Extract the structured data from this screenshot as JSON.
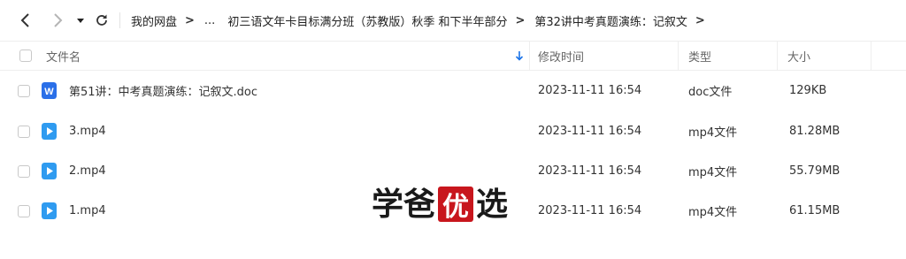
{
  "nav": {
    "back_icon": "chevron-left-icon",
    "forward_icon": "chevron-right-icon",
    "history_icon": "caret-down-icon",
    "refresh_icon": "refresh-icon"
  },
  "breadcrumb": {
    "items": [
      "我的网盘",
      "...",
      "初三语文年卡目标满分班（苏教版）秋季 和下半年部分",
      "第32讲中考真题演练：记叙文"
    ],
    "separator": ">"
  },
  "table": {
    "columns": {
      "name": "文件名",
      "modified": "修改时间",
      "type": "类型",
      "size": "大小"
    },
    "sort_icon": "sort-down-arrow-icon",
    "sort_color": "#1a73e8",
    "rows": [
      {
        "name": "第51讲：中考真题演练：记叙文.doc",
        "modified": "2023-11-11 16:54",
        "type": "doc文件",
        "size": "129KB",
        "icon": "word-doc-icon",
        "icon_color": "#2a6fe8"
      },
      {
        "name": "3.mp4",
        "modified": "2023-11-11 16:54",
        "type": "mp4文件",
        "size": "81.28MB",
        "icon": "video-play-icon",
        "icon_color": "#2f9bf0"
      },
      {
        "name": "2.mp4",
        "modified": "2023-11-11 16:54",
        "type": "mp4文件",
        "size": "55.79MB",
        "icon": "video-play-icon",
        "icon_color": "#2f9bf0"
      },
      {
        "name": "1.mp4",
        "modified": "2023-11-11 16:54",
        "type": "mp4文件",
        "size": "61.15MB",
        "icon": "video-play-icon",
        "icon_color": "#2f9bf0"
      }
    ]
  },
  "watermark": {
    "chars": [
      "学",
      "爸",
      "优",
      "选"
    ],
    "seal_color": "#c8161d"
  }
}
